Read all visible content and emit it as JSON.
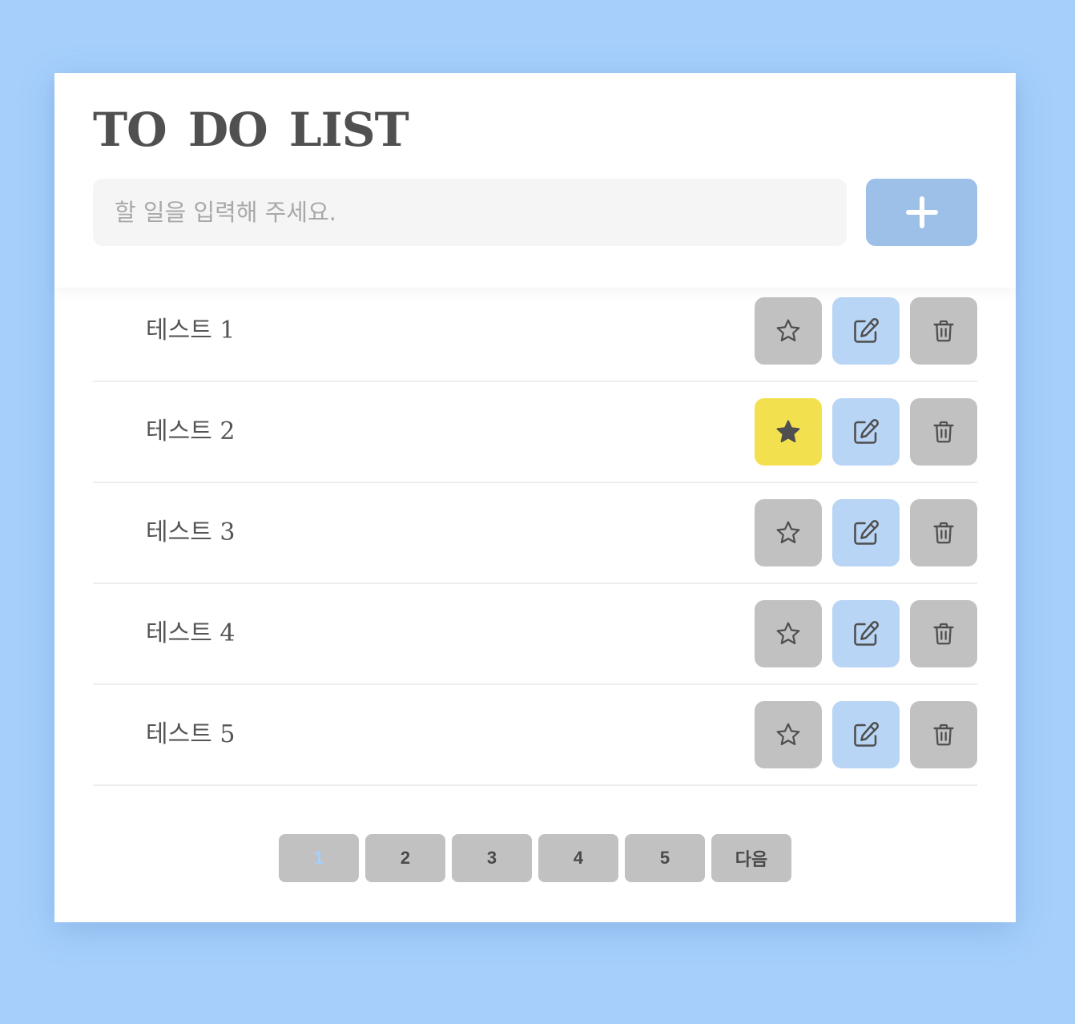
{
  "app": {
    "title": "TO DO LIST"
  },
  "input": {
    "placeholder": "할 일을 입력해 주세요.",
    "value": ""
  },
  "add_button": {
    "icon": "plus-icon"
  },
  "todos": [
    {
      "text": "테스트 1",
      "starred": false
    },
    {
      "text": "테스트 2",
      "starred": true
    },
    {
      "text": "테스트 3",
      "starred": false
    },
    {
      "text": "테스트 4",
      "starred": false
    },
    {
      "text": "테스트 5",
      "starred": false
    }
  ],
  "row_icons": {
    "star": "star-icon",
    "edit": "edit-icon",
    "delete": "trash-icon"
  },
  "pagination": {
    "pages": [
      "1",
      "2",
      "3",
      "4",
      "5"
    ],
    "current": "1",
    "next_label": "다음"
  },
  "colors": {
    "background": "#a6cffc",
    "card": "#ffffff",
    "add_button": "#9dc0e9",
    "star_inactive": "#c1c1c1",
    "star_active": "#f3e04e",
    "edit_button": "#b9d5f5",
    "delete_button": "#c1c1c1",
    "page_button": "#c1c1c1",
    "current_page_text": "#a6cffc",
    "text": "#555555"
  }
}
